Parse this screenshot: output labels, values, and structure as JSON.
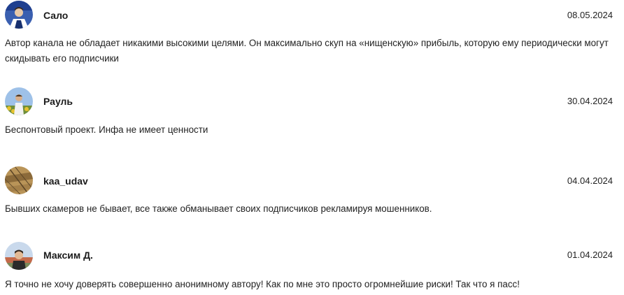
{
  "reviews": [
    {
      "author": "Сало",
      "date": "08.05.2024",
      "text": "Автор канала не обладает никакими высокими целями. Он максимально скуп на «нищенскую» прибыль, которую ему периодически могут скидывать его подписчики",
      "avatar_colors": [
        "#1f3f8f",
        "#5b7fcf",
        "#e8c9a8"
      ]
    },
    {
      "author": "Рауль",
      "date": "30.04.2024",
      "text": "Беспонтовый проект. Инфа не имеет ценности",
      "avatar_colors": [
        "#9ec1e8",
        "#e6c22e",
        "#f3f3f3"
      ]
    },
    {
      "author": "kaa_udav",
      "date": "04.04.2024",
      "text": "Бывших скамеров не бывает, все также обманывает своих подписчиков рекламируя мошенников.",
      "avatar_colors": [
        "#8b6a3a",
        "#b99458",
        "#5a4426"
      ]
    },
    {
      "author": "Максим Д.",
      "date": "01.04.2024",
      "text": "Я точно не хочу доверять совершенно анонимному автору! Как по мне это просто огромнейшие риски! Так что я пасс!",
      "avatar_colors": [
        "#c9d9ec",
        "#2a2a2a",
        "#e2b995"
      ]
    }
  ]
}
